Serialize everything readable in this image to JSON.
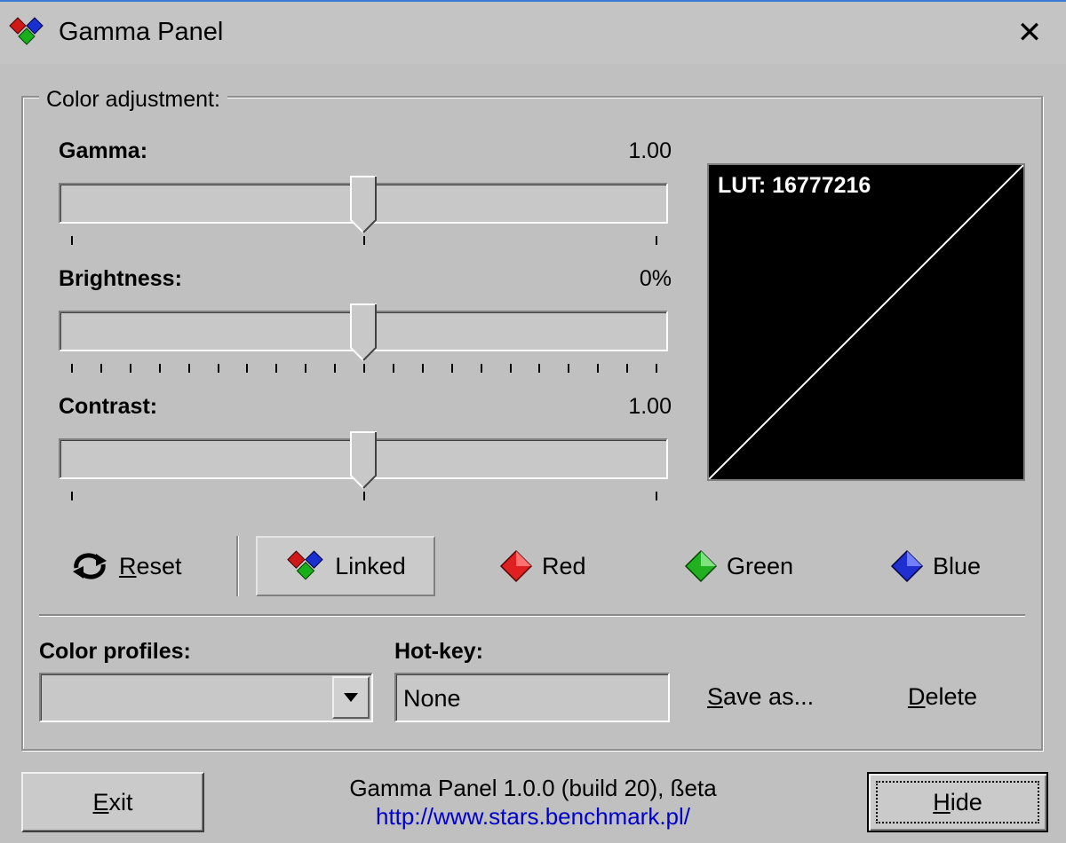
{
  "window": {
    "title": "Gamma Panel",
    "app_icon": "rgb-diamonds-icon",
    "close_icon": "close-icon",
    "close_glyph": "✕"
  },
  "group": {
    "legend": "Color adjustment:"
  },
  "sliders": {
    "gamma": {
      "label": "Gamma:",
      "value_text": "1.00",
      "position": 0.5
    },
    "brightness": {
      "label": "Brightness:",
      "value_text": "0%",
      "position": 0.5
    },
    "contrast": {
      "label": "Contrast:",
      "value_text": "1.00",
      "position": 0.5
    }
  },
  "lut": {
    "label": "LUT: 16777216"
  },
  "channels": {
    "reset": {
      "label_first": "R",
      "label_rest": "eset",
      "icon": "reset-arrows-icon"
    },
    "linked": {
      "label": "Linked",
      "icon": "rgb-diamonds-icon",
      "selected": true
    },
    "red": {
      "label": "Red",
      "icon": "red-diamond-icon",
      "color": "#e02020"
    },
    "green": {
      "label": "Green",
      "icon": "green-diamond-icon",
      "color": "#20b020"
    },
    "blue": {
      "label": "Blue",
      "icon": "blue-diamond-icon",
      "color": "#2030d0"
    }
  },
  "profiles": {
    "label": "Color profiles:",
    "selected": "",
    "dropdown_icon": "chevron-down-icon"
  },
  "hotkey": {
    "label": "Hot-key:",
    "value": "None"
  },
  "actions": {
    "save_first": "S",
    "save_rest": "ave as...",
    "delete_first": "D",
    "delete_rest": "elete"
  },
  "footer": {
    "exit_first": "E",
    "exit_rest": "xit",
    "hide_first": "H",
    "hide_rest": "ide",
    "version": "Gamma Panel 1.0.0 (build 20), ßeta",
    "url": "http://www.stars.benchmark.pl/"
  }
}
